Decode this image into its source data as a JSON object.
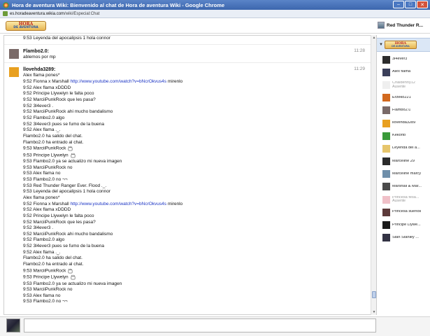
{
  "window": {
    "title": "Hora de aventura Wiki: Bienvenido al chat de Hora de aventura Wiki - Google Chrome",
    "url_host": "es.horadeaventura.wikia.com",
    "url_path": "/wiki/Especial:Chat",
    "buttons": {
      "minimize": "–",
      "maximize": "□",
      "close": "✕"
    },
    "favicon": "wikia-favicon-icon"
  },
  "header": {
    "logo": {
      "line1": "HORA",
      "line2": "DE AVENTURA"
    },
    "current_user": "Red Thunder R..."
  },
  "messages": [
    {
      "kind": "continuation",
      "lines": [
        {
          "t": "9:53 Leyenda del apocalipsis 1 hola connor"
        }
      ]
    },
    {
      "kind": "message",
      "user": "Flambo2.0:",
      "time": "11:28",
      "avatar_color": "#7a6a68",
      "lines": [
        {
          "t": "ablemos por mp"
        }
      ]
    },
    {
      "kind": "message",
      "user": "llovehda3289:",
      "time": "11:29",
      "avatar_color": "#e8a020",
      "lines": [
        {
          "t": "Alex flama pones*"
        },
        {
          "t": "9:52 Fionna x Marshall ",
          "link": "http://www.youtube.com/watch?v=bNcrOkvus4s",
          "after": " mirenlo"
        },
        {
          "t": "9:52 Alex flama xDDDD"
        },
        {
          "t": "9:52 Principe Llywelyn le falta poco"
        },
        {
          "t": "9:52 MarciiPunkRock que les pasa?"
        },
        {
          "t": "9:52 3l4ever3 ."
        },
        {
          "t": "9:52 MarciiPunkRock ahi mucho bandalismo"
        },
        {
          "t": "9:52 Flambo2.0 algo"
        },
        {
          "t": "9:52 3l4ever3 pues se fumo de la buena"
        },
        {
          "t": "9:52 Alex flama ._."
        },
        {
          "t": "Flambo2.0 ha salido del chat."
        },
        {
          "t": "Flambo2.0 ha entrado al chat."
        },
        {
          "t": "9:53 MarciiPunkRock",
          "emote": true
        },
        {
          "t": "9:53 Principe Llywelyn",
          "emote": true
        },
        {
          "t": "9:53 Flambo2.0 ya se actualizo mi nueva imagen"
        },
        {
          "t": "9:53 MarciiPunkRock no"
        },
        {
          "t": "9:53 Alex flama no"
        },
        {
          "t": "9:53 Flambo2.0 no ¬¬"
        },
        {
          "t": "9:53 Red Thunder Ranger Ever. Flood ._."
        },
        {
          "t": "9:53 Leyenda del apocalipsis 1 hola connor"
        },
        {
          "t": "Alex flama pones*"
        },
        {
          "t": "9:52 Fionna x Marshall ",
          "link": "http://www.youtube.com/watch?v=bNcrOkvus4s",
          "after": " mirenlo"
        },
        {
          "t": "9:52 Alex flama xDDDD"
        },
        {
          "t": "9:52 Principe Llywelyn le falta poco"
        },
        {
          "t": "9:52 MarciiPunkRock que les pasa?"
        },
        {
          "t": "9:52 3l4ever3 ."
        },
        {
          "t": "9:52 MarciiPunkRock ahi mucho bandalismo"
        },
        {
          "t": "9:52 Flambo2.0 algo"
        },
        {
          "t": "9:52 3l4ever3 pues se fumo de la buena"
        },
        {
          "t": "9:52 Alex flama ._."
        },
        {
          "t": "Flambo2.0 ha salido del chat."
        },
        {
          "t": "Flambo2.0 ha entrado al chat."
        },
        {
          "t": "9:53 MarciiPunkRock",
          "emote": true
        },
        {
          "t": "9:53 Principe Llywelyn",
          "emote": true
        },
        {
          "t": "9:53 Flambo2.0 ya se actualizo mi nueva imagen"
        },
        {
          "t": "9:53 MarciiPunkRock no"
        },
        {
          "t": "9:53 Alex flama no"
        },
        {
          "t": "9:53 Flambo2.0 no ¬¬"
        }
      ]
    }
  ],
  "sidebar": {
    "room_logo": {
      "line1": "HORA",
      "line2": "DE AVENTURA"
    },
    "users": [
      {
        "name": "3l4ever3",
        "color": "#2c2c2c"
      },
      {
        "name": "Alex flama",
        "color": "#3b3f5a"
      },
      {
        "name": "Chaldenny12",
        "status": "Ausente",
        "color": "#efefef"
      },
      {
        "name": "Erzeko221",
        "color": "#d2691e"
      },
      {
        "name": "Flambo2.0",
        "color": "#7a6a68"
      },
      {
        "name": "llovehda3289",
        "color": "#e8a020"
      },
      {
        "name": "Kekorto",
        "color": "#3a9a3a"
      },
      {
        "name": "Leyenda del a...",
        "color": "#e6c56b"
      },
      {
        "name": "Marceline 29",
        "color": "#2b2b2b"
      },
      {
        "name": "Marceline marcy",
        "color": "#6f8faa"
      },
      {
        "name": "Marshall & Mar...",
        "color": "#4a4a4a"
      },
      {
        "name": "Princesa fesa...",
        "status": "Ausente",
        "color": "#f0c0c8"
      },
      {
        "name": "Princesa sueños",
        "color": "#5c3a3a"
      },
      {
        "name": "Principe Llywe...",
        "color": "#1b1b1b"
      },
      {
        "name": "Stan Stanley ...",
        "color": "#333344"
      }
    ]
  },
  "input": {
    "value": ""
  }
}
